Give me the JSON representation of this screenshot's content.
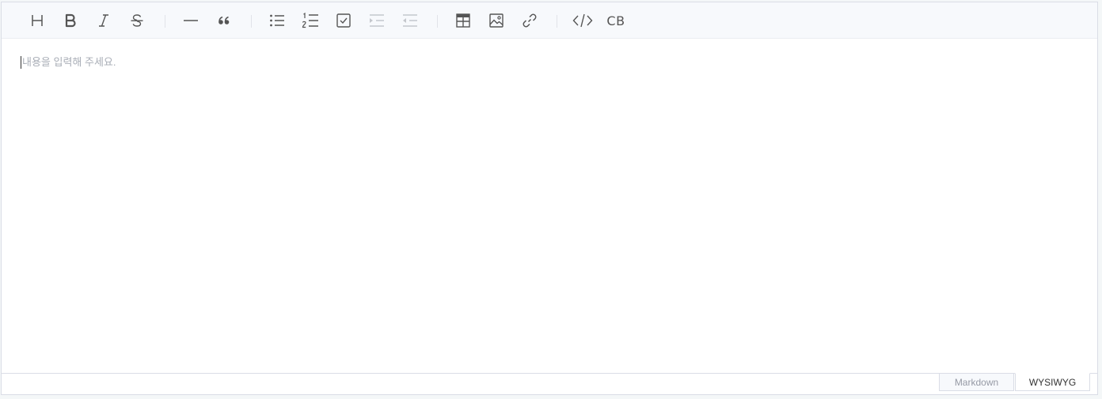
{
  "toolbar": {
    "buttons": [
      {
        "name": "heading",
        "icon": "heading-icon",
        "enabled": true
      },
      {
        "name": "bold",
        "icon": "bold-icon",
        "enabled": true
      },
      {
        "name": "italic",
        "icon": "italic-icon",
        "enabled": true
      },
      {
        "name": "strike",
        "icon": "strike-icon",
        "enabled": true
      },
      {
        "name": "horizontal-line",
        "icon": "horizontal-rule-icon",
        "enabled": true
      },
      {
        "name": "quote",
        "icon": "quote-icon",
        "enabled": true
      },
      {
        "name": "bullet-list",
        "icon": "bullet-list-icon",
        "enabled": true
      },
      {
        "name": "ordered-list",
        "icon": "ordered-list-icon",
        "enabled": true
      },
      {
        "name": "task-list",
        "icon": "task-list-icon",
        "enabled": true
      },
      {
        "name": "indent",
        "icon": "indent-icon",
        "enabled": false
      },
      {
        "name": "outdent",
        "icon": "outdent-icon",
        "enabled": false
      },
      {
        "name": "table",
        "icon": "table-icon",
        "enabled": true
      },
      {
        "name": "image",
        "icon": "image-icon",
        "enabled": true
      },
      {
        "name": "link",
        "icon": "link-icon",
        "enabled": true
      },
      {
        "name": "code",
        "icon": "code-icon",
        "enabled": true
      },
      {
        "name": "code-block",
        "icon": "code-block-icon",
        "label": "CB",
        "enabled": true
      }
    ]
  },
  "editor": {
    "placeholder": "내용을 입력해 주세요."
  },
  "modes": {
    "markdown_label": "Markdown",
    "wysiwyg_label": "WYSIWYG",
    "active": "WYSIWYG"
  },
  "colors": {
    "icon": "#555555",
    "icon_disabled": "#c4c7cd",
    "toolbar_bg": "#f7f9fc",
    "border": "#dadde6"
  }
}
